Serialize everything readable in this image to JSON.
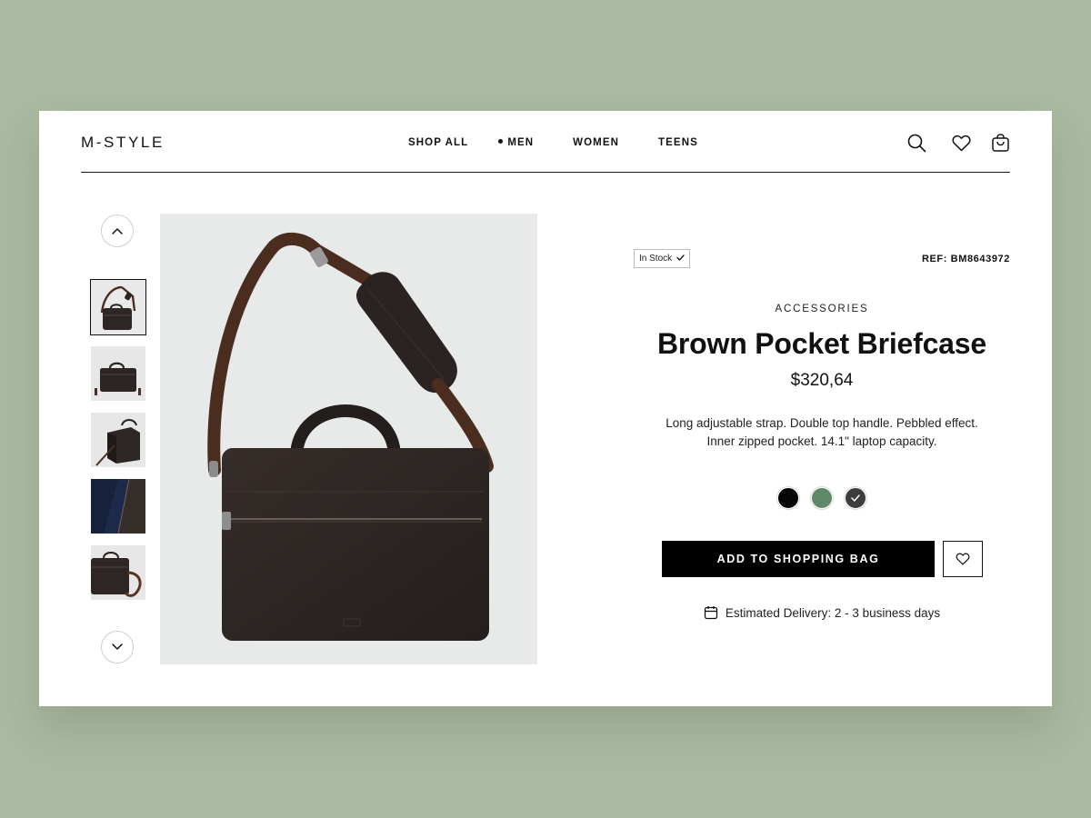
{
  "brand": {
    "logo": "M-STYLE"
  },
  "nav": {
    "items": [
      {
        "label": "SHOP ALL",
        "active": false
      },
      {
        "label": "MEN",
        "active": true
      },
      {
        "label": "WOMEN",
        "active": false
      },
      {
        "label": "TEENS",
        "active": false
      }
    ]
  },
  "header_icons": [
    "search-icon",
    "heart-icon",
    "shopping-bag-icon"
  ],
  "gallery": {
    "thumbnails": [
      "thumbnail-front-strap",
      "thumbnail-front",
      "thumbnail-side",
      "thumbnail-interior",
      "thumbnail-detail"
    ],
    "active_index": 0
  },
  "product": {
    "stock": "In Stock",
    "ref": "REF: BM8643972",
    "category": "ACCESSORIES",
    "title": "Brown Pocket Briefcase",
    "price": "$320,64",
    "description_line1": "Long adjustable strap. Double top handle. Pebbled effect.",
    "description_line2": "Inner zipped pocket. 14.1\" laptop capacity.",
    "colors": [
      {
        "name": "black",
        "hex": "#050505",
        "selected": false
      },
      {
        "name": "green",
        "hex": "#5f8a6a",
        "selected": false
      },
      {
        "name": "charcoal",
        "hex": "#3d3d3d",
        "selected": true
      }
    ],
    "add_to_bag": "ADD TO SHOPPING BAG",
    "delivery": "Estimated Delivery: 2 - 3 business days"
  }
}
